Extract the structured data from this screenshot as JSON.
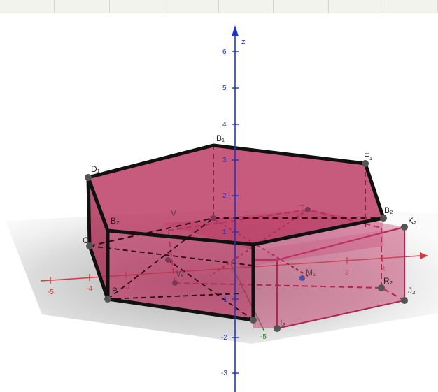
{
  "app": {
    "toolbar_cells": 8
  },
  "colors": {
    "solid_fill": "#b8325e",
    "edge_dark": "#111111",
    "edge_prism": "#b32550",
    "axis_x": "#d63a3a",
    "axis_y": "#2a8a2a",
    "axis_z": "#1f35c8",
    "plane": "#b9b9b9"
  },
  "axes": {
    "z_label": "z",
    "z_ticks": [
      "6",
      "5",
      "4",
      "3",
      "2",
      "1",
      "-1",
      "-2",
      "-3"
    ],
    "x_ticks": [
      "-5",
      "-4",
      "-3",
      "3",
      "4"
    ],
    "y_ticks": [
      "-5"
    ]
  },
  "points": {
    "top_back": "B₁",
    "top_right": "E₁",
    "top_left": "D₁",
    "mid_right": "B₂",
    "prism_corner_k": "K₂",
    "prism_corner_j": "J₂",
    "prism_corner_r": "R₂",
    "prism_corner_i": "I₂",
    "front_left_upper": "B₂",
    "left_mid": "O",
    "left_bottom": "B",
    "inner_v": "V",
    "inner_t": "T₁",
    "inner_m": "M₁",
    "inner_w": "W"
  }
}
